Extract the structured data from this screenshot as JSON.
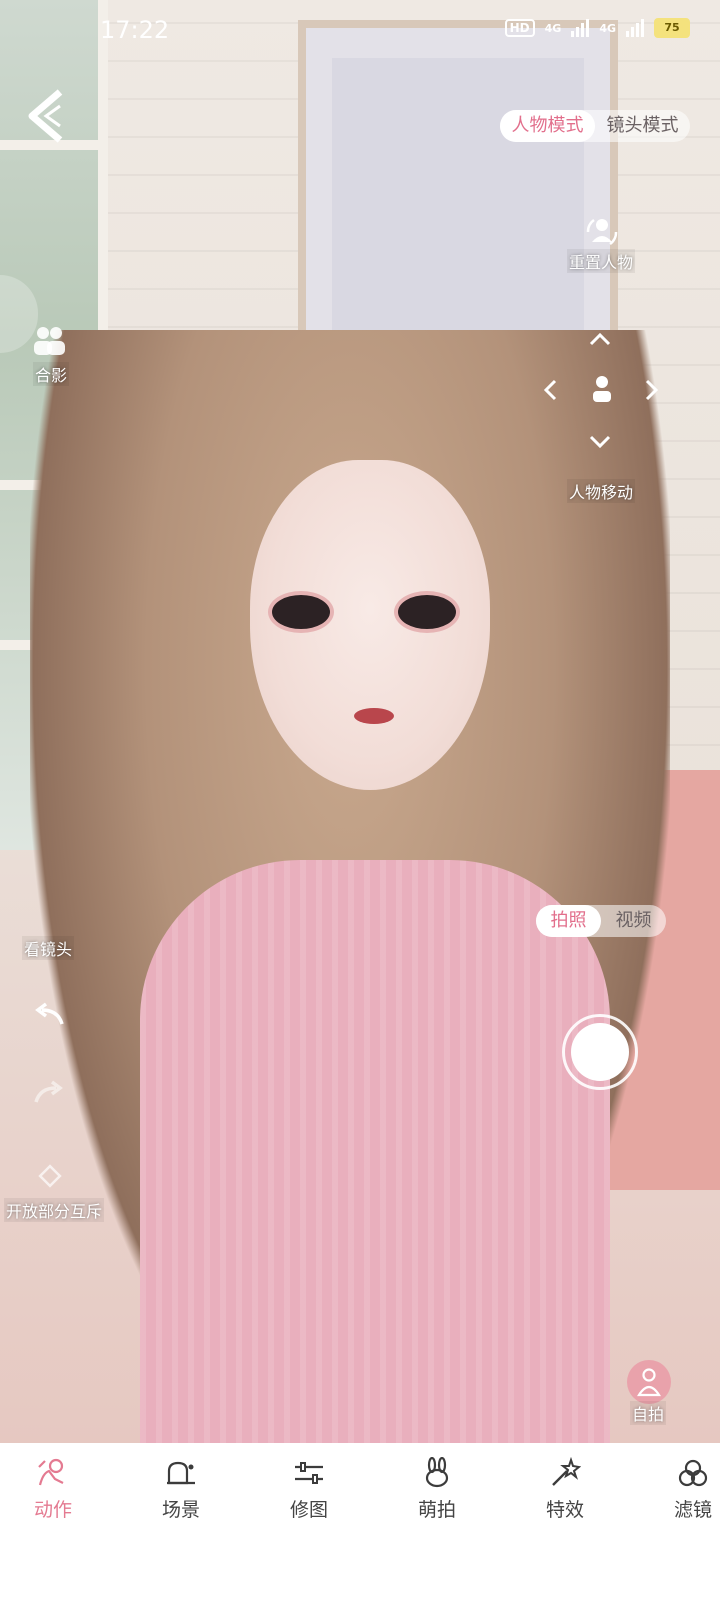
{
  "status_bar": {
    "time": "17:22",
    "hd": "HD",
    "signal_1": "4G",
    "signal_2": "4G",
    "battery": "75"
  },
  "mode_toggle": {
    "character_mode": "人物模式",
    "camera_mode": "镜头模式",
    "active": "character_mode"
  },
  "right_controls": {
    "reset_character": "重置人物",
    "move_character": "人物移动"
  },
  "left_controls": {
    "group_photo": "合影",
    "look_at_camera": "看镜头",
    "open_partial_exclusion": "开放部分互斥"
  },
  "capture_toggle": {
    "photo": "拍照",
    "video": "视频",
    "active": "photo"
  },
  "selfie_label": "自拍",
  "bottom_nav": [
    {
      "label": "动作",
      "icon": "pose-icon",
      "active": true
    },
    {
      "label": "场景",
      "icon": "scene-icon",
      "active": false
    },
    {
      "label": "修图",
      "icon": "adjust-icon",
      "active": false
    },
    {
      "label": "萌拍",
      "icon": "bunny-icon",
      "active": false
    },
    {
      "label": "特效",
      "icon": "magic-wand-icon",
      "active": false
    },
    {
      "label": "滤镜",
      "icon": "filter-icon",
      "active": false
    }
  ],
  "colors": {
    "accent": "#e47a91",
    "white": "#ffffff"
  }
}
